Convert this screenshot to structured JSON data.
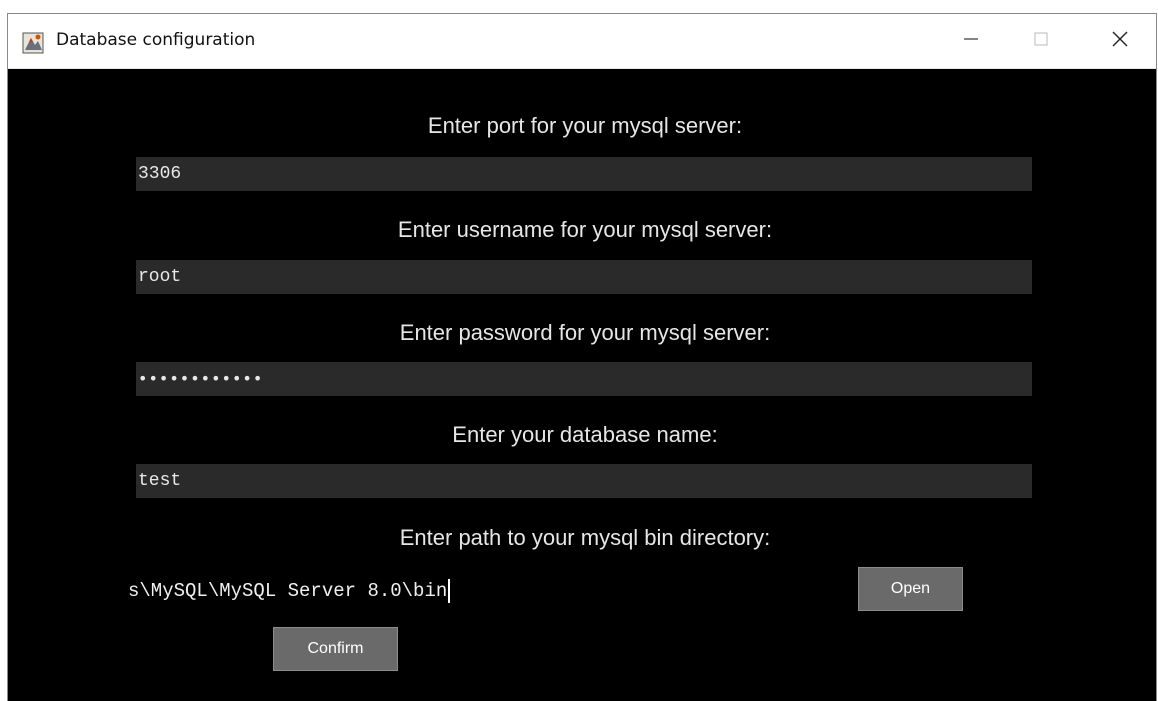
{
  "window": {
    "title": "Database configuration",
    "controls": {
      "minimize_icon": "minimize-icon",
      "maximize_icon": "maximize-icon",
      "close_icon": "close-icon"
    }
  },
  "form": {
    "port": {
      "label": "Enter port for your mysql server:",
      "value": "3306"
    },
    "username": {
      "label": "Enter username for your mysql server:",
      "value": "root"
    },
    "password": {
      "label": "Enter password for your mysql server:",
      "value": "••••••••••••"
    },
    "database": {
      "label": "Enter your database name:",
      "value": "test"
    },
    "bin_path": {
      "label": "Enter path to your mysql bin directory:",
      "value": "s\\MySQL\\MySQL Server 8.0\\bin"
    }
  },
  "buttons": {
    "open_label": "Open",
    "confirm_label": "Confirm"
  },
  "colors": {
    "background": "#000000",
    "field": "#2a2a2a",
    "button": "#6a6a6a",
    "text": "#e6e6e6"
  }
}
